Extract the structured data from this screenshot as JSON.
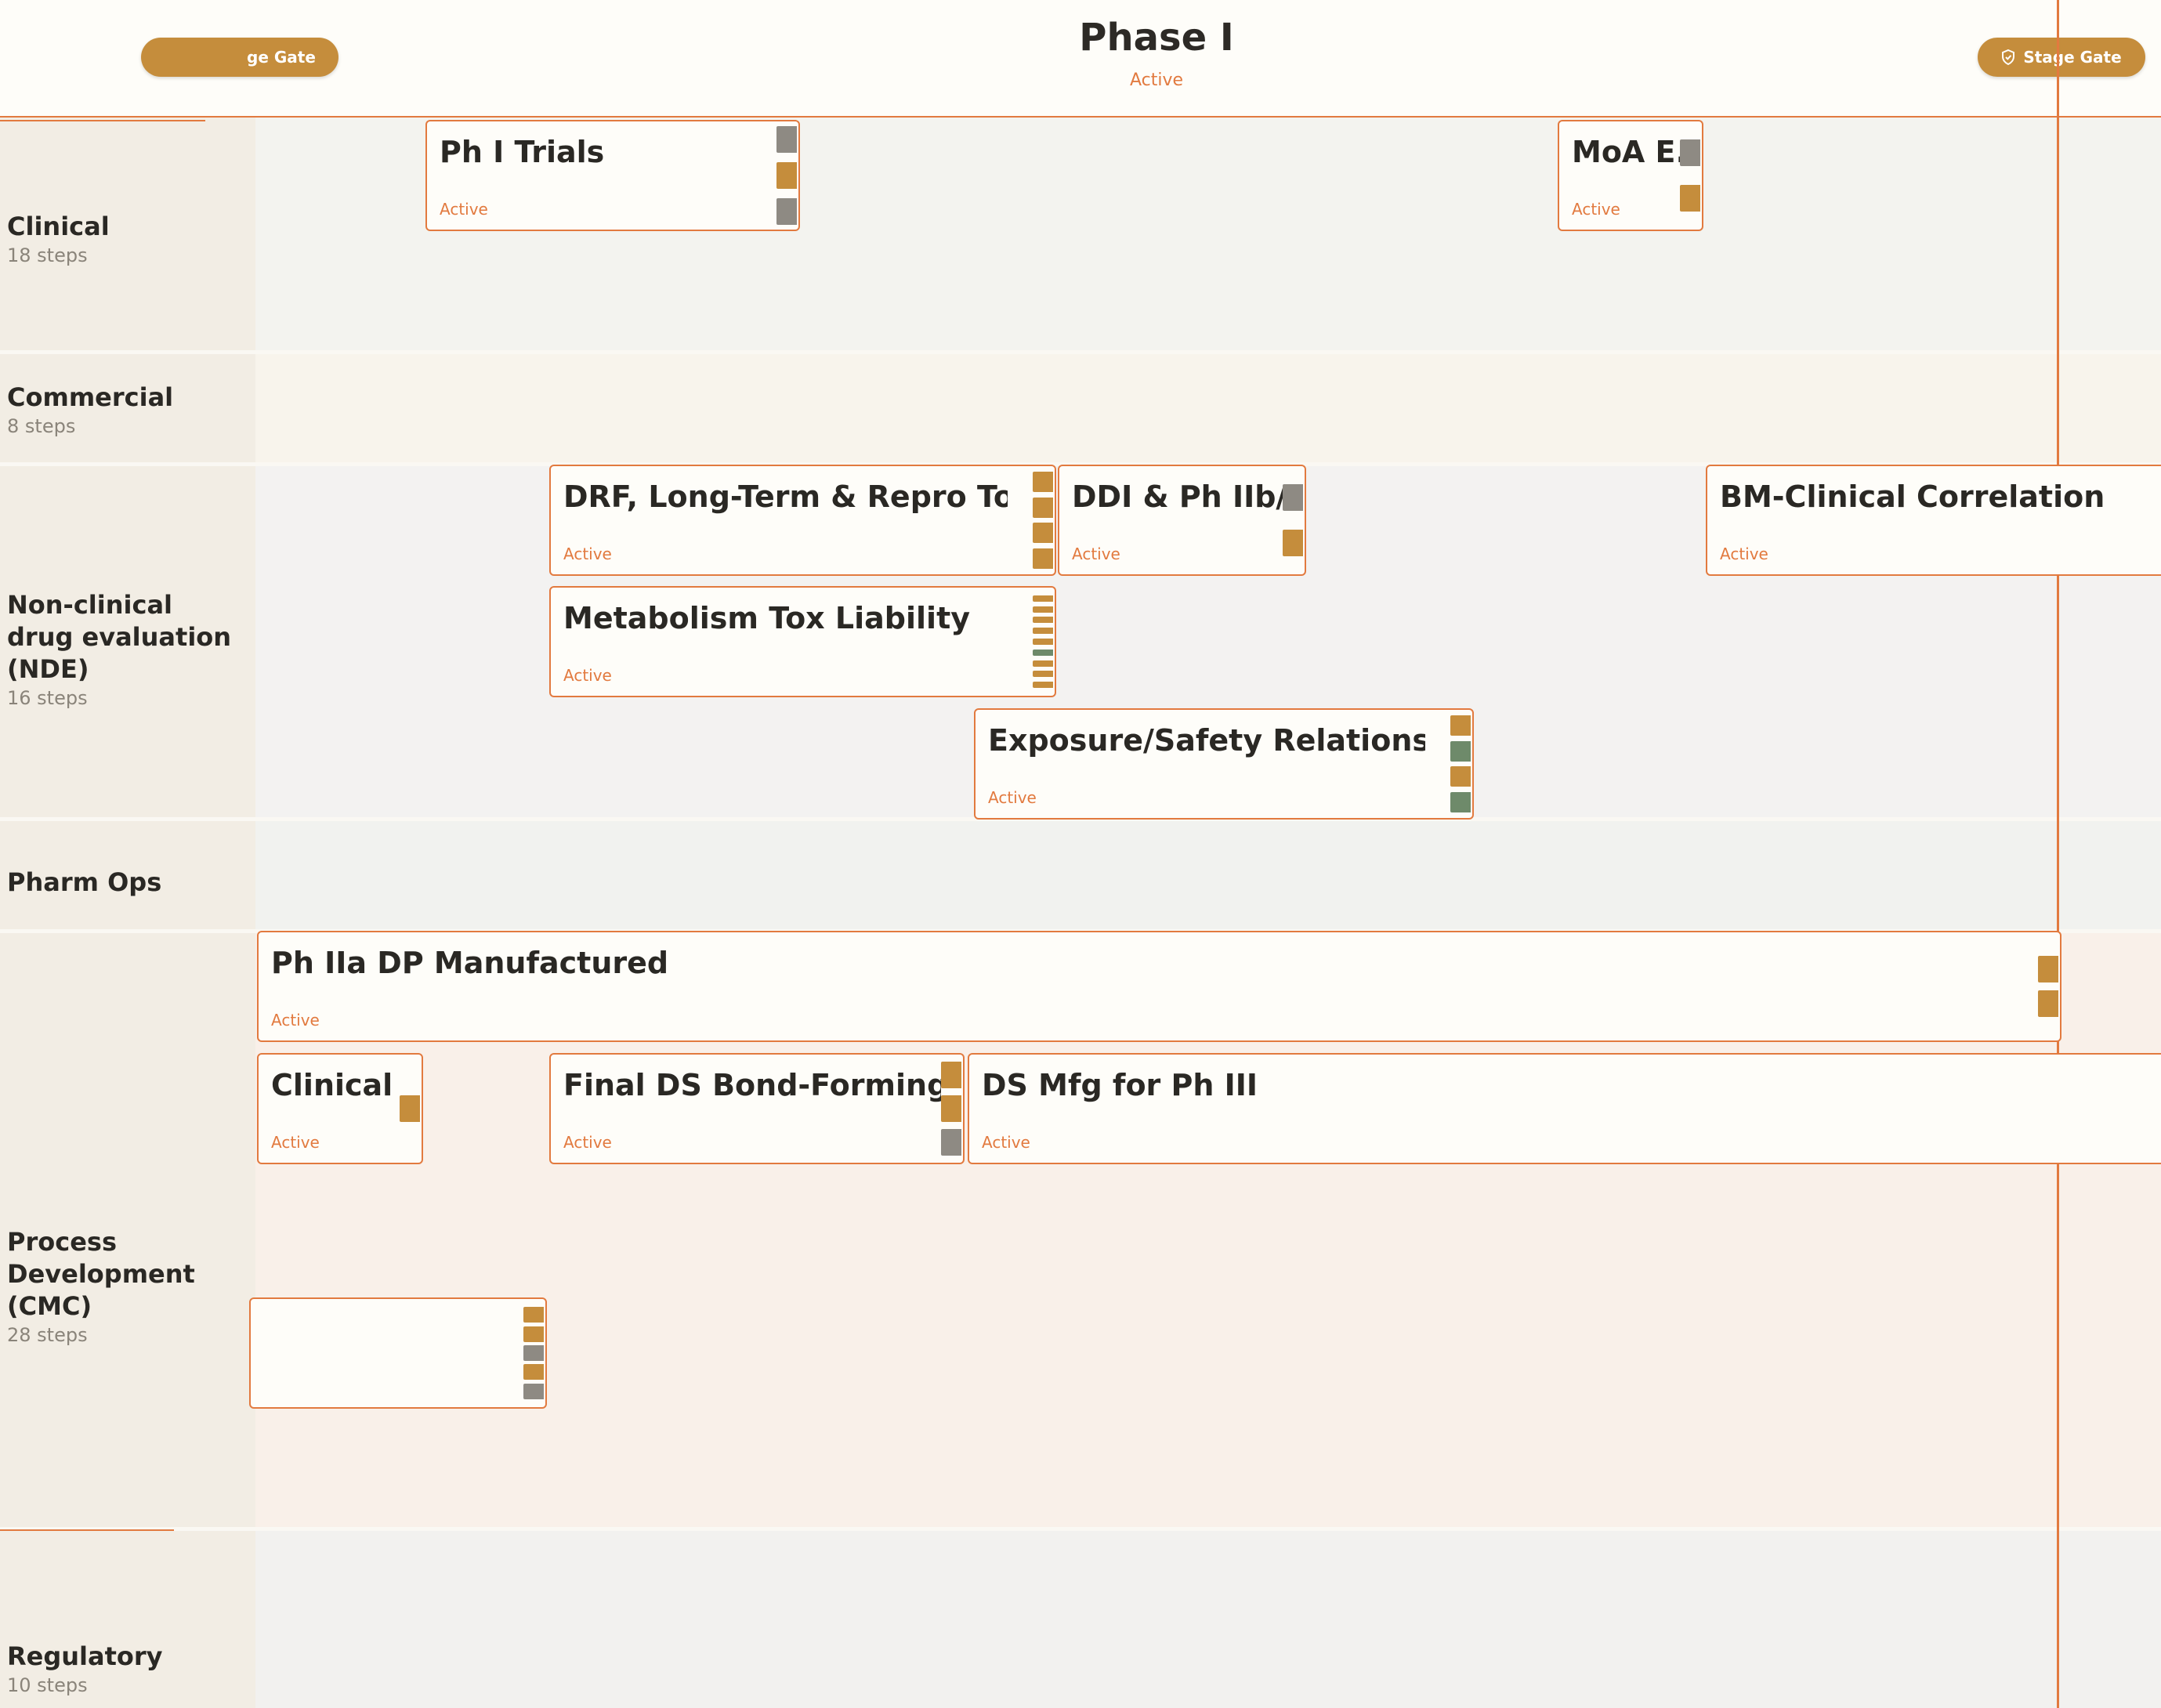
{
  "header": {
    "phase_title": "Phase I",
    "phase_status": "Active",
    "stage_gate_left": "ge Gate",
    "stage_gate_right": "Stage Gate"
  },
  "colors": {
    "accent": "#e27a3f",
    "gate": "#c58d3c",
    "tab_gold": "#c58d3c",
    "tab_grey": "#8e8a83",
    "tab_green": "#6e8a6a"
  },
  "lanes": [
    {
      "id": "clinical",
      "name": "Clinical",
      "steps": "18 steps"
    },
    {
      "id": "commercial",
      "name": "Commercial",
      "steps": "8 steps"
    },
    {
      "id": "nde",
      "name": "Non-clinical drug evaluation (NDE)",
      "steps": "16 steps"
    },
    {
      "id": "pharm-ops",
      "name": "Pharm Ops",
      "steps": ""
    },
    {
      "id": "cmc",
      "name": "Process Development (CMC)",
      "steps": "28 steps"
    },
    {
      "id": "regulatory",
      "name": "Regulatory",
      "steps": "10 steps"
    }
  ],
  "tasks": [
    {
      "title": "Ph I Trials",
      "status": "Active"
    },
    {
      "title": "MoA E..",
      "status": "Active"
    },
    {
      "title": "DRF, Long-Term & Repro Tox",
      "status": "Active"
    },
    {
      "title": "DDI & Ph IIb/I...",
      "status": "Active"
    },
    {
      "title": "BM-Clinical Correlation",
      "status": "Active"
    },
    {
      "title": "Metabolism Tox Liability",
      "status": "Active"
    },
    {
      "title": "Exposure/Safety Relationship",
      "status": "Active"
    },
    {
      "title": "Ph IIa DP Manufactured",
      "status": "Active"
    },
    {
      "title": "Clinical ...",
      "status": "Active"
    },
    {
      "title": "Final DS Bond-Forming R...",
      "status": "Active"
    },
    {
      "title": "DS Mfg for Ph III",
      "status": "Active"
    },
    {
      "title": "",
      "status": ""
    }
  ]
}
